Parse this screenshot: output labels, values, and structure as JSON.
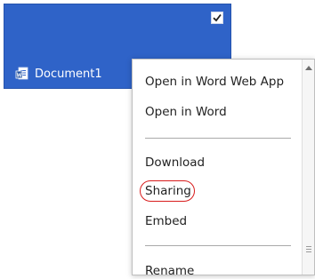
{
  "tile": {
    "document_name": "Document1",
    "selected": true
  },
  "menu": {
    "items": [
      {
        "label": "Open in Word Web App"
      },
      {
        "label": "Open in Word"
      },
      {
        "label": "Download"
      },
      {
        "label": "Sharing"
      },
      {
        "label": "Embed"
      },
      {
        "label": "Rename"
      }
    ]
  },
  "colors": {
    "tile_blue": "#2f63c8",
    "highlight_red": "#d81c1c"
  }
}
